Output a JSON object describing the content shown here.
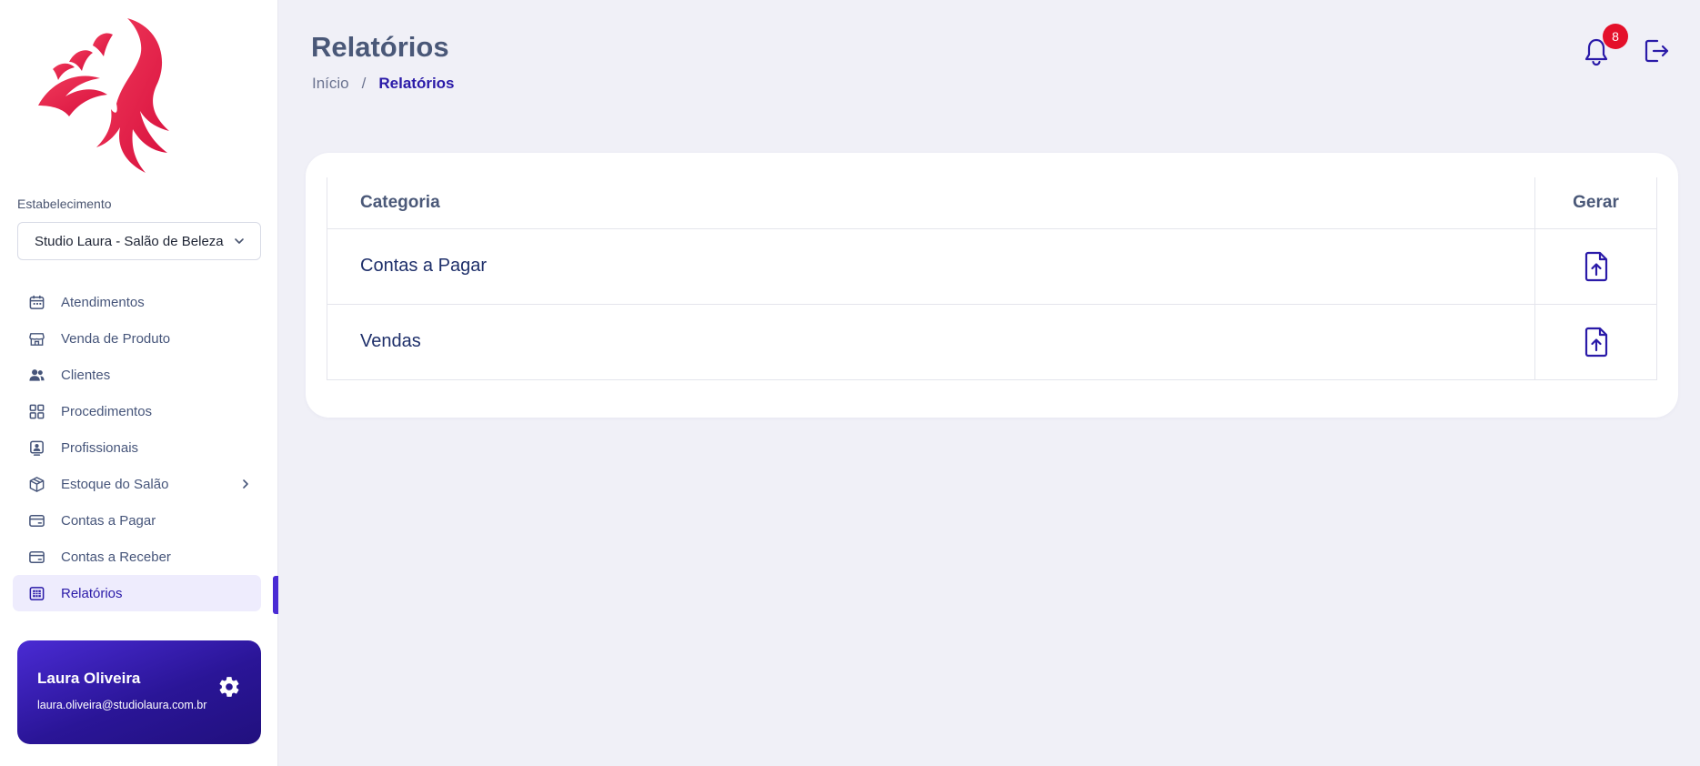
{
  "sidebar": {
    "establishment_label": "Estabelecimento",
    "establishment_value": "Studio Laura - Salão de Beleza",
    "items": [
      {
        "label": "Atendimentos",
        "icon": "calendar-icon"
      },
      {
        "label": "Venda de Produto",
        "icon": "store-icon"
      },
      {
        "label": "Clientes",
        "icon": "users-icon"
      },
      {
        "label": "Procedimentos",
        "icon": "grid-icon"
      },
      {
        "label": "Profissionais",
        "icon": "badge-icon"
      },
      {
        "label": "Estoque do Salão",
        "icon": "box-icon"
      },
      {
        "label": "Contas a Pagar",
        "icon": "card-icon"
      },
      {
        "label": "Contas a Receber",
        "icon": "card-icon"
      },
      {
        "label": "Relatórios",
        "icon": "report-icon",
        "active": true
      }
    ]
  },
  "user": {
    "name": "Laura Oliveira",
    "email": "laura.oliveira@studiolaura.com.br"
  },
  "header": {
    "title": "Relatórios",
    "breadcrumb": [
      "Início",
      "/",
      "Relatórios"
    ],
    "notification_count": "8"
  },
  "table": {
    "columns": [
      "Categoria",
      "Gerar"
    ],
    "rows": [
      {
        "category": "Contas a Pagar"
      },
      {
        "category": "Vendas"
      }
    ]
  },
  "colors": {
    "accent": "#4a2bd4",
    "accent_dark": "#21107e",
    "badge": "#e4102a",
    "logo": "#e8204a"
  }
}
